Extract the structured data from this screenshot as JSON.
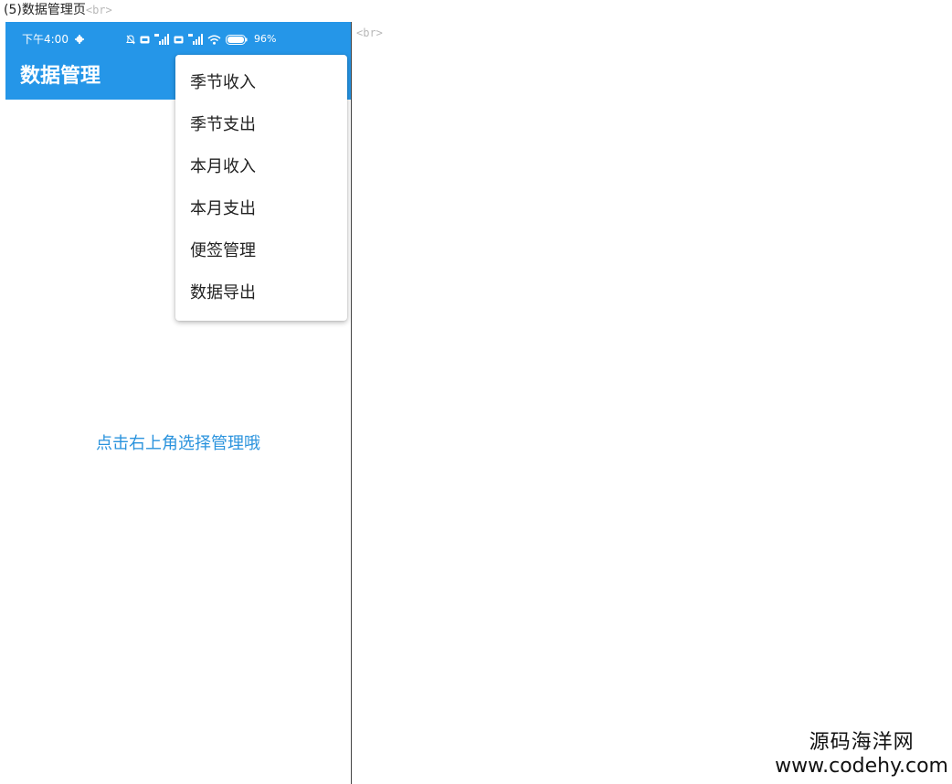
{
  "document": {
    "caption": "(5)数据管理页",
    "br_tag": "<br>"
  },
  "statusbar": {
    "time": "下午4:00",
    "battery": "96%",
    "icons": [
      "gear-icon",
      "mute-icon",
      "hd-icon",
      "signal-4g-icon",
      "hd-icon",
      "signal-4g-icon",
      "wifi-icon",
      "battery-icon"
    ]
  },
  "appbar": {
    "title": "数据管理",
    "color": "#2596e8"
  },
  "menu": {
    "items": [
      {
        "label": "季节收入"
      },
      {
        "label": "季节支出"
      },
      {
        "label": "本月收入"
      },
      {
        "label": "本月支出"
      },
      {
        "label": "便签管理"
      },
      {
        "label": "数据导出"
      }
    ]
  },
  "main": {
    "hint": "点击右上角选择管理哦",
    "hint_color": "#2a93dd"
  },
  "watermark": {
    "name": "源码海洋网",
    "url": "www.codehy.com"
  }
}
